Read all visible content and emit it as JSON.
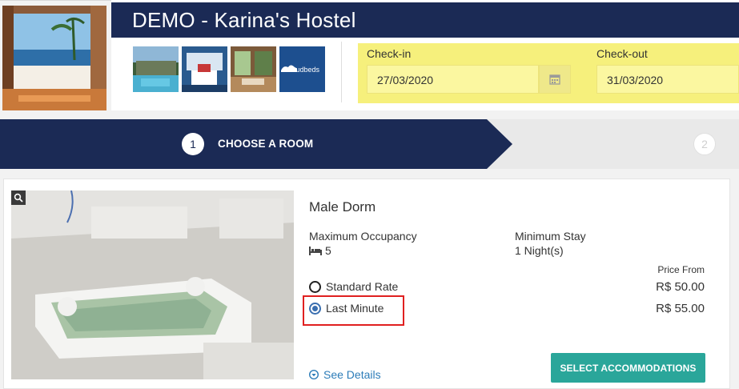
{
  "header": {
    "title": "DEMO - Karina's Hostel",
    "thumbnails": [
      "pool-thumbnail",
      "room-thumbnail",
      "lounge-thumbnail",
      "cloudbeds-thumbnail"
    ],
    "cloudbeds_text": "Coudbeds"
  },
  "dates": {
    "checkin_label": "Check-in",
    "checkin_value": "27/03/2020",
    "checkout_label": "Check-out",
    "checkout_value": "31/03/2020",
    "highlight_color": "#f6f07c"
  },
  "steps": [
    {
      "number": "1",
      "label": "CHOOSE A ROOM",
      "active": true
    },
    {
      "number": "2",
      "label": "",
      "active": false
    }
  ],
  "room": {
    "title": "Male Dorm",
    "occupancy_label": "Maximum Occupancy",
    "occupancy_value": "5",
    "min_stay_label": "Minimum Stay",
    "min_stay_value": "1 Night(s)",
    "price_from_label": "Price From",
    "rates": [
      {
        "name": "Standard Rate",
        "price": "R$ 50.00",
        "selected": false
      },
      {
        "name": "Last Minute",
        "price": "R$ 55.00",
        "selected": true
      }
    ],
    "details_link": "See Details",
    "select_button": "SELECT ACCOMMODATIONS"
  },
  "colors": {
    "navy": "#1b2a55",
    "teal": "#2aa69a",
    "annotation_red": "#e02020",
    "link_blue": "#2c7cb8"
  }
}
